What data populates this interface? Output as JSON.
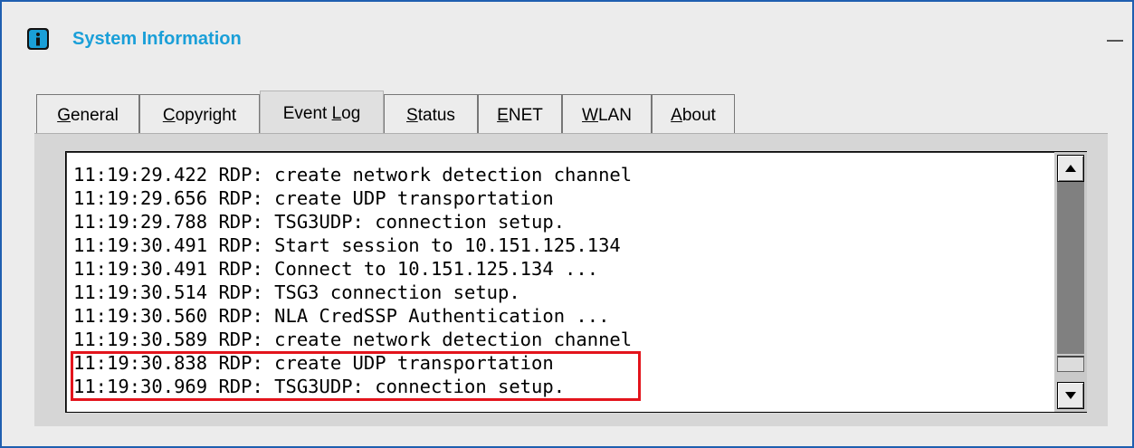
{
  "window": {
    "title": "System Information",
    "title_color": "#1a9fd8",
    "border_color": "#1f5fb0"
  },
  "icons": {
    "title": "info-icon",
    "minimize": "minimize-icon",
    "scroll_up": "arrow-up-icon",
    "scroll_down": "arrow-down-icon"
  },
  "tabs": [
    {
      "pre": "",
      "key": "G",
      "post": "eneral",
      "active": false
    },
    {
      "pre": "",
      "key": "C",
      "post": "opyright",
      "active": false
    },
    {
      "pre": "Event ",
      "key": "L",
      "post": "og",
      "active": true
    },
    {
      "pre": "",
      "key": "S",
      "post": "tatus",
      "active": false
    },
    {
      "pre": "",
      "key": "E",
      "post": "NET",
      "active": false
    },
    {
      "pre": "",
      "key": "W",
      "post": "LAN",
      "active": false
    },
    {
      "pre": "",
      "key": "A",
      "post": "bout",
      "active": false
    }
  ],
  "event_log": {
    "lines": [
      "11:19:29.422 RDP: create network detection channel",
      "11:19:29.656 RDP: create UDP transportation",
      "11:19:29.788 RDP: TSG3UDP: connection setup.",
      "11:19:30.491 RDP: Start session to 10.151.125.134",
      "11:19:30.491 RDP: Connect to 10.151.125.134 ...",
      "11:19:30.514 RDP: TSG3 connection setup.",
      "11:19:30.560 RDP: NLA CredSSP Authentication ...",
      "11:19:30.589 RDP: create network detection channel",
      "11:19:30.838 RDP: create UDP transportation",
      "11:19:30.969 RDP: TSG3UDP: connection setup."
    ],
    "highlighted_lines": [
      8,
      9
    ],
    "highlight_color": "#e3141c"
  }
}
